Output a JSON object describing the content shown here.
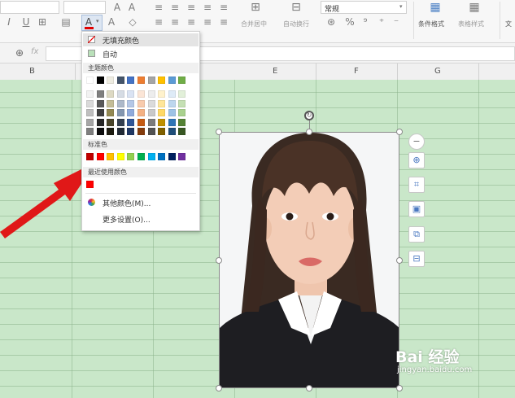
{
  "ribbon": {
    "number_format": "常规",
    "merge_label": "合并居中",
    "wrap_label": "自动换行",
    "percent": "%",
    "cond_format_label": "条件格式",
    "table_style_label": "表格样式",
    "extra_label": "文",
    "fx_label": "fx"
  },
  "columns": [
    "B",
    "E",
    "F",
    "G"
  ],
  "color_menu": {
    "no_fill": "无填充颜色",
    "auto": "自动",
    "theme_header": "主题颜色",
    "theme_top": [
      "#ffffff",
      "#000000",
      "#eeece1",
      "#44546a",
      "#4472c4",
      "#ed7d31",
      "#a5a5a5",
      "#ffc000",
      "#5b9bd5",
      "#70ad47"
    ],
    "theme_shades": [
      [
        "#f2f2f2",
        "#7f7f7f",
        "#ddd9c3",
        "#d6dce4",
        "#dae3f3",
        "#fbe5d6",
        "#ededed",
        "#fff2cc",
        "#deebf7",
        "#e2f0d9"
      ],
      [
        "#d9d9d9",
        "#595959",
        "#c4bd97",
        "#adb9ca",
        "#b4c7e7",
        "#f8cbad",
        "#dbdbdb",
        "#ffe699",
        "#bdd7ee",
        "#c5e0b4"
      ],
      [
        "#bfbfbf",
        "#3f3f3f",
        "#938953",
        "#8497b0",
        "#8faadc",
        "#f4b183",
        "#c9c9c9",
        "#ffd966",
        "#9dc3e6",
        "#a9d18e"
      ],
      [
        "#a6a6a6",
        "#262626",
        "#494429",
        "#333f50",
        "#2f5597",
        "#c55a11",
        "#7b7b7b",
        "#bf9000",
        "#2e75b6",
        "#548235"
      ],
      [
        "#7f7f7f",
        "#0d0d0d",
        "#1d1b10",
        "#222a35",
        "#203864",
        "#843c0c",
        "#525252",
        "#7f6000",
        "#1f4e79",
        "#385723"
      ]
    ],
    "standard_header": "标准色",
    "standard": [
      "#c00000",
      "#ff0000",
      "#ffc000",
      "#ffff00",
      "#92d050",
      "#00b050",
      "#00b0f0",
      "#0070c0",
      "#002060",
      "#7030a0"
    ],
    "recent_header": "最近使用颜色",
    "recent": [
      "#ff0000"
    ],
    "more_colors": "其他颜色(M)...",
    "more_settings": "更多设置(O)..."
  },
  "photo": {
    "float_tools": [
      "minus-icon",
      "zoom-icon",
      "crop-icon",
      "fill-icon",
      "replace-icon",
      "layout-icon"
    ]
  },
  "watermark": {
    "logo": "Bai 经验",
    "url": "jingyan.baidu.com"
  }
}
